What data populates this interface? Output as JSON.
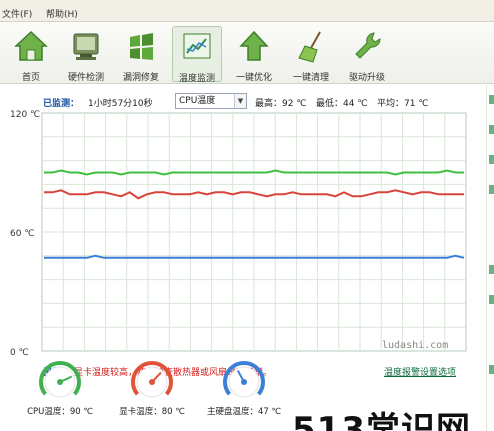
{
  "menubar": {
    "items": [
      "文件(F)",
      "帮助(H)"
    ]
  },
  "toolbar": {
    "items": [
      {
        "label": "首页",
        "icon": "home-icon"
      },
      {
        "label": "硬件检测",
        "icon": "hardware-icon"
      },
      {
        "label": "漏洞修复",
        "icon": "windows-flag-icon"
      },
      {
        "label": "温度监测",
        "icon": "chart-monitor-icon",
        "active": true
      },
      {
        "label": "一键优化",
        "icon": "up-arrow-icon"
      },
      {
        "label": "一键清理",
        "icon": "broom-icon"
      },
      {
        "label": "驱动升级",
        "icon": "wrench-icon"
      }
    ]
  },
  "monitor": {
    "label": "已监测：",
    "elapsed": "1小时57分10秒",
    "sensor": "CPU温度",
    "max": "最高：92 ℃",
    "min": "最低：44 ℃",
    "avg": "平均：71 ℃"
  },
  "chart_data": {
    "type": "line",
    "y_ticks": [
      "120 ℃",
      "60 ℃",
      "0 ℃"
    ],
    "ylim": [
      0,
      120
    ],
    "grid": true,
    "series": [
      {
        "color": "#3fbf3f",
        "values": [
          90,
          90,
          91,
          90,
          90,
          89,
          90,
          90,
          90,
          89,
          90,
          90,
          90,
          90,
          89,
          90,
          90,
          90,
          90,
          90,
          90,
          90,
          90,
          90,
          90,
          90,
          90,
          91,
          90,
          90,
          90,
          90,
          90,
          90,
          90,
          90,
          90,
          90,
          90,
          90,
          90,
          89,
          90,
          90,
          90,
          90,
          90,
          91,
          90,
          90
        ]
      },
      {
        "color": "#d9443a",
        "values": [
          80,
          80,
          81,
          79,
          79,
          79,
          80,
          80,
          79,
          78,
          80,
          77,
          79,
          80,
          80,
          79,
          79,
          79,
          80,
          79,
          80,
          80,
          79,
          80,
          80,
          79,
          78,
          79,
          79,
          80,
          79,
          79,
          79,
          79,
          78,
          80,
          78,
          78,
          79,
          80,
          80,
          81,
          80,
          79,
          80,
          80,
          79,
          79,
          79,
          79
        ]
      },
      {
        "color": "#3b7fd6",
        "values": [
          47,
          47,
          47,
          47,
          47,
          47,
          48,
          47,
          47,
          47,
          47,
          47,
          47,
          47,
          47,
          47,
          47,
          47,
          47,
          47,
          47,
          47,
          47,
          47,
          47,
          47,
          47,
          47,
          47,
          47,
          47,
          47,
          47,
          47,
          47,
          47,
          47,
          47,
          47,
          47,
          47,
          47,
          47,
          47,
          47,
          47,
          47,
          47,
          48,
          47
        ]
      }
    ]
  },
  "report": {
    "label": "报告：",
    "text": "显卡温度较高，建议检查散热器或风扇是否正常。",
    "alarm_link": "温度报警设置选项"
  },
  "gauges": [
    {
      "label": "CPU温度：90 ℃",
      "value": 90,
      "color": "#3fb24f"
    },
    {
      "label": "显卡温度：80 ℃",
      "value": 80,
      "color": "#e0523a"
    },
    {
      "label": "主硬盘温度：47 ℃",
      "value": 47,
      "color": "#3b7fd6"
    }
  ],
  "watermarks": {
    "site": "ludashi.com",
    "big": "513常识网"
  }
}
